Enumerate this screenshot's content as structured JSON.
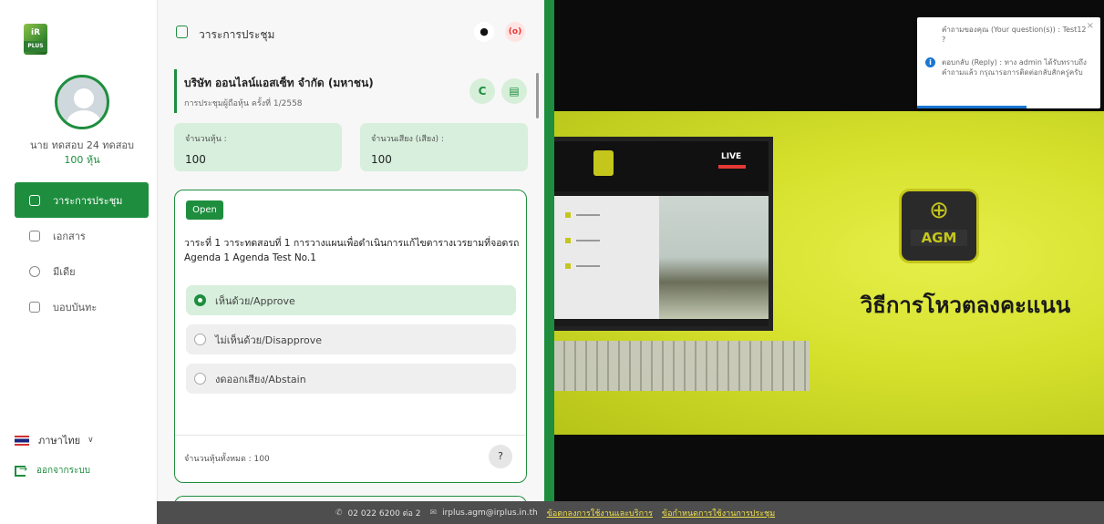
{
  "sidebar": {
    "logo_text": "iR",
    "logo_sub": "PLUS",
    "username": "นาย ทดสอบ 24 ทดสอบ",
    "shares": "100 หุ้น",
    "items": [
      {
        "label": "วาระการประชุม",
        "active": true
      },
      {
        "label": "เอกสาร"
      },
      {
        "label": "มีเดีย"
      },
      {
        "label": "บอบบันทะ"
      }
    ],
    "language": "ภาษาไทย",
    "logout": "ออกจากระบบ"
  },
  "topbar": {
    "title": "วาระการประชุม",
    "chat_icon": "chat-icon",
    "live_icon": "live-icon",
    "live_label": "(o)"
  },
  "company": {
    "name": "บริษัท ออนไลน์แอสเซ็ท จำกัด (มหาชน)",
    "meeting": "การประชุมผู้ถือหุ้น ครั้งที่ 1/2558"
  },
  "stats": {
    "shares_label": "จำนวนหุ้น :",
    "shares_value": "100",
    "votes_label": "จำนวนเสียง (เสียง) :",
    "votes_value": "100"
  },
  "agenda": {
    "status": "Open",
    "title_th": "วาระที่ 1 วาระทดสอบที่ 1 การวางแผนเพื่อดำเนินการแก้ไขตารางเวรยามที่จอดรถ",
    "title_en": "Agenda 1 Agenda Test No.1",
    "options": [
      {
        "label": "เห็นด้วย/Approve",
        "selected": true
      },
      {
        "label": "ไม่เห็นด้วย/Disapprove",
        "selected": false
      },
      {
        "label": "งดออกเสียง/Abstain",
        "selected": false
      }
    ],
    "total": "จำนวนหุ้นทั้งหมด : 100",
    "help": "?"
  },
  "video": {
    "live_label": "LIVE",
    "agm_label": "AGM",
    "vote_title": "วิธีการโหวตลงคะแนน"
  },
  "toast": {
    "question": "คำถามของคุณ (Your question(s)) : Test12 ?",
    "reply": "ตอบกลับ (Reply) : ทาง admin ได้รับทราบถึงคำถามแล้ว กรุณารอการติดต่อกลับสักครู่ครับ",
    "close": "×"
  },
  "footer": {
    "phone": "02 022 6200 ต่อ 2",
    "email": "irplus.agm@irplus.in.th",
    "terms": "ข้อตกลงการใช้งานและบริการ",
    "rules": "ข้อกำหนดการใช้งานการประชุม"
  },
  "colors": {
    "accent": "#1e8e3e",
    "accent_light": "#d7efdc",
    "stage": "#d5e02c",
    "footer_bg": "#4e4e4e",
    "footer_link": "#f2e14a"
  }
}
